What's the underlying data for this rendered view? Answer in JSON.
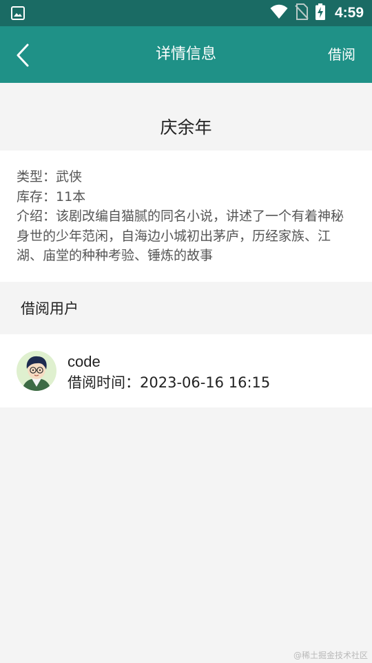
{
  "status_bar": {
    "time": "4:59",
    "icons": [
      "gallery-icon",
      "wifi-icon",
      "no-sim-icon",
      "battery-charging-icon"
    ]
  },
  "app_bar": {
    "title": "详情信息",
    "action_label": "借阅",
    "back_icon": "back-arrow-icon"
  },
  "book": {
    "title": "庆余年",
    "type_line": "类型：武侠",
    "stock_line": "库存：11本",
    "intro_line": "介绍：该剧改编自猫腻的同名小说，讲述了一个有着神秘身世的少年范闲，自海边小城初出茅庐，历经家族、江湖、庙堂的种种考验、锤炼的故事"
  },
  "borrowers": {
    "section_title": "借阅用户",
    "items": [
      {
        "name": "code",
        "time_line": "借阅时间：2023-06-16 16:15",
        "avatar": "avatar-icon"
      }
    ]
  },
  "watermark": "@稀土掘金技术社区",
  "colors": {
    "status_bar": "#1a6b64",
    "app_bar": "#1f9187",
    "page_bg": "#f4f4f4",
    "card_bg": "#ffffff"
  }
}
